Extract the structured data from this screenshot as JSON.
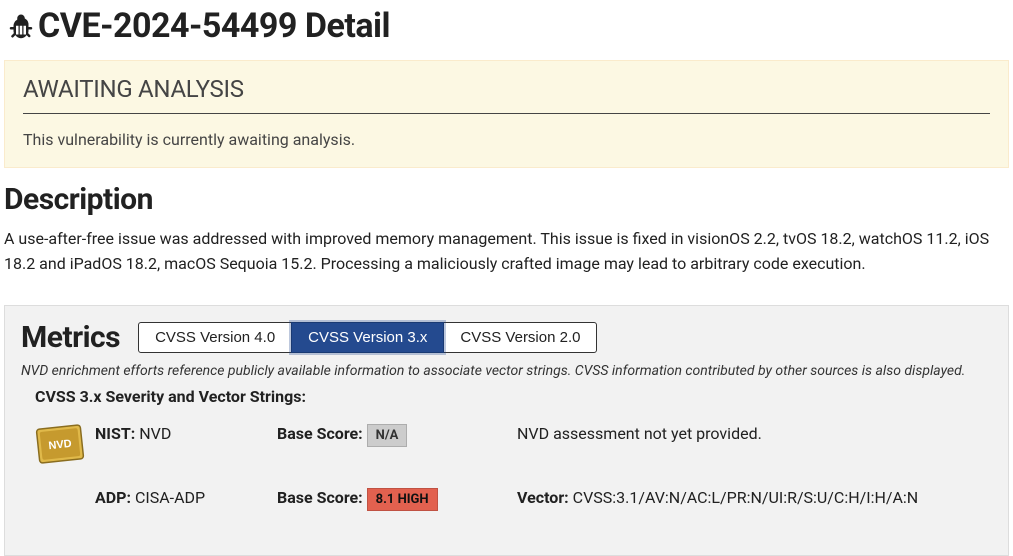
{
  "title": "CVE-2024-54499 Detail",
  "alert": {
    "heading": "AWAITING ANALYSIS",
    "body": "This vulnerability is currently awaiting analysis."
  },
  "description": {
    "heading": "Description",
    "text": "A use-after-free issue was addressed with improved memory management. This issue is fixed in visionOS 2.2, tvOS 18.2, watchOS 11.2, iOS 18.2 and iPadOS 18.2, macOS Sequoia 15.2. Processing a maliciously crafted image may lead to arbitrary code execution."
  },
  "metrics": {
    "heading": "Metrics",
    "tabs": {
      "v4": "CVSS Version 4.0",
      "v3": "CVSS Version 3.x",
      "v2": "CVSS Version 2.0"
    },
    "note": "NVD enrichment efforts reference publicly available information to associate vector strings. CVSS information contributed by other sources is also displayed.",
    "severity_heading": "CVSS 3.x Severity and Vector Strings:",
    "rows": {
      "nist": {
        "source_label": "NIST:",
        "source_value": "NVD",
        "score_label": "Base Score:",
        "score_badge": "N/A",
        "vector_text": "NVD assessment not yet provided."
      },
      "adp": {
        "source_label": "ADP:",
        "source_value": "CISA-ADP",
        "score_label": "Base Score:",
        "score_badge": "8.1 HIGH",
        "vector_label": "Vector:",
        "vector_value": "CVSS:3.1/AV:N/AC:L/PR:N/UI:R/S:U/C:H/I:H/A:N"
      }
    }
  }
}
